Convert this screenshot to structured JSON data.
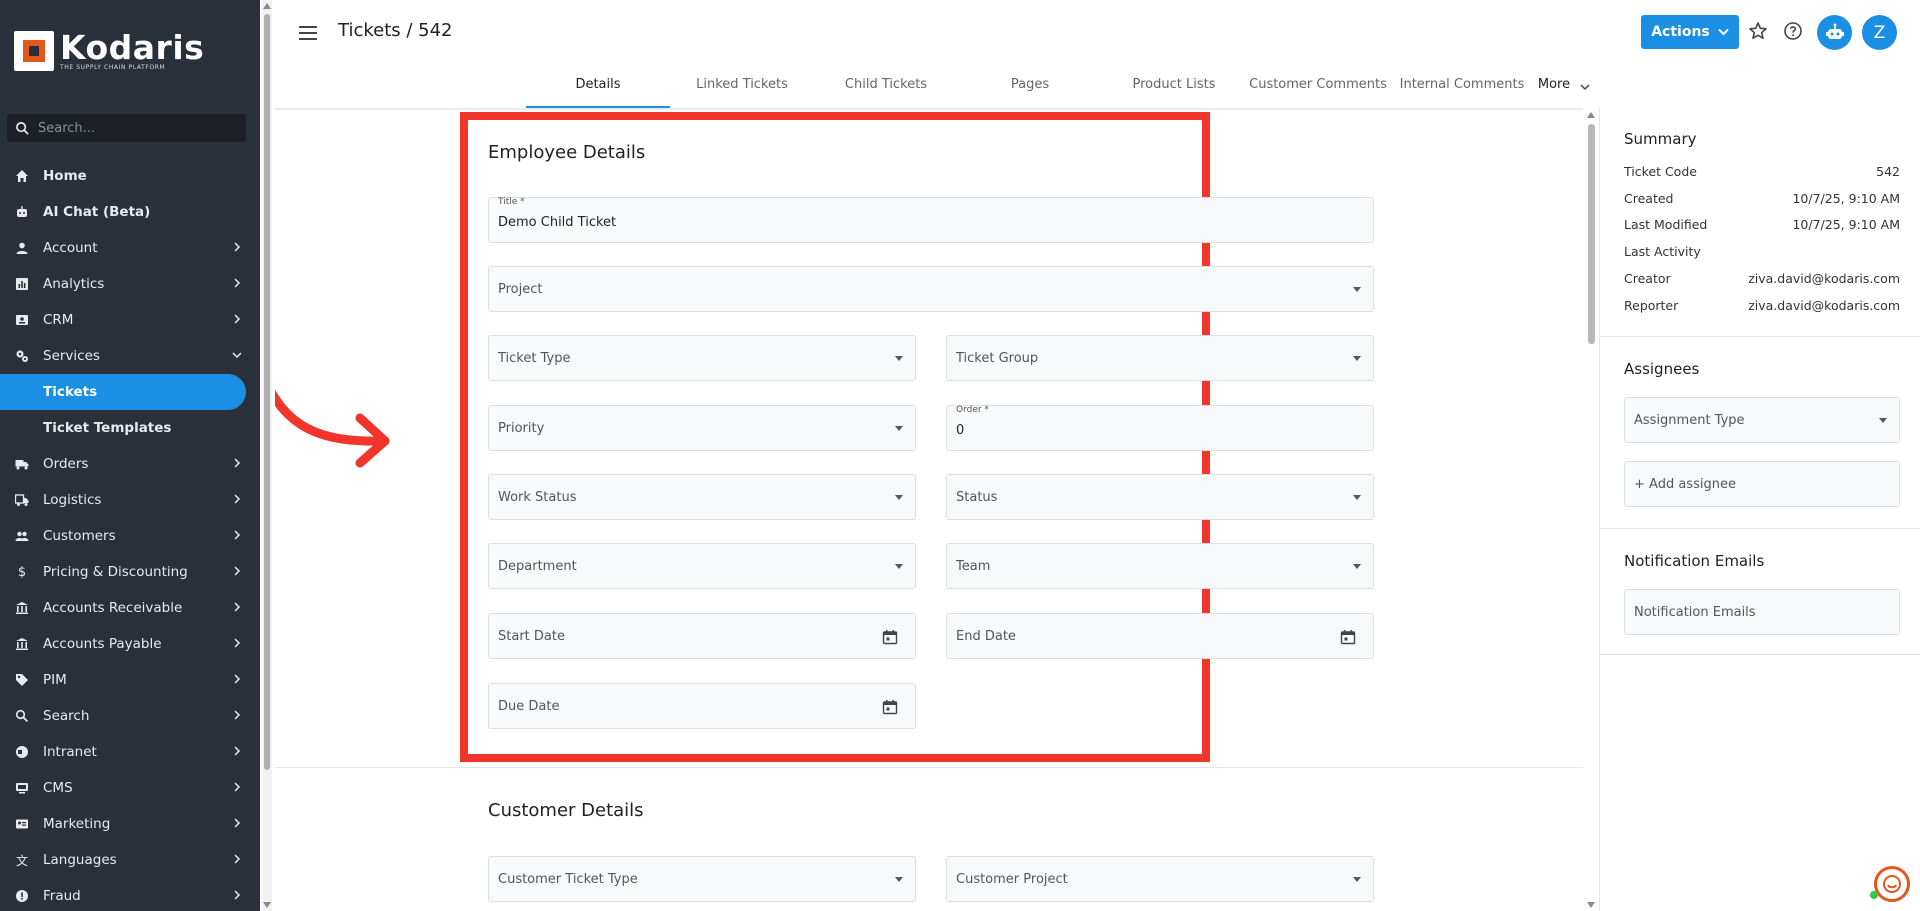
{
  "sidebar": {
    "logo_name": "Kodaris",
    "logo_tagline": "THE SUPPLY CHAIN PLATFORM",
    "search_placeholder": "Search...",
    "items": [
      {
        "label": "Home",
        "icon": "home-icon"
      },
      {
        "label": "AI Chat (Beta)",
        "icon": "robot-icon"
      },
      {
        "label": "Account",
        "icon": "person-icon"
      },
      {
        "label": "Analytics",
        "icon": "chart-icon"
      },
      {
        "label": "CRM",
        "icon": "contacts-icon"
      },
      {
        "label": "Services",
        "icon": "gears-icon"
      },
      {
        "label": "Tickets"
      },
      {
        "label": "Ticket Templates"
      },
      {
        "label": "Orders",
        "icon": "truck-icon"
      },
      {
        "label": "Logistics",
        "icon": "shipping-icon"
      },
      {
        "label": "Customers",
        "icon": "people-icon"
      },
      {
        "label": "Pricing & Discounting",
        "icon": "dollar-icon"
      },
      {
        "label": "Accounts Receivable",
        "icon": "bank-icon"
      },
      {
        "label": "Accounts Payable",
        "icon": "bank-icon"
      },
      {
        "label": "PIM",
        "icon": "tag-icon"
      },
      {
        "label": "Search",
        "icon": "search-icon"
      },
      {
        "label": "Intranet",
        "icon": "globe-icon"
      },
      {
        "label": "CMS",
        "icon": "monitor-icon"
      },
      {
        "label": "Marketing",
        "icon": "id-card-icon"
      },
      {
        "label": "Languages",
        "icon": "translate-icon"
      },
      {
        "label": "Fraud",
        "icon": "alert-icon"
      }
    ]
  },
  "header": {
    "title": "Tickets / 542",
    "actions_label": "Actions",
    "avatar_initial": "Z"
  },
  "tabs": [
    "Details",
    "Linked Tickets",
    "Child Tickets",
    "Pages",
    "Product Lists",
    "Customer Comments",
    "Internal Comments",
    "More"
  ],
  "employee_details": {
    "title": "Employee Details",
    "title_field_label": "Title *",
    "title_field_value": "Demo Child Ticket",
    "project": "Project",
    "ticket_type": "Ticket Type",
    "ticket_group": "Ticket Group",
    "priority": "Priority",
    "order_label": "Order *",
    "order_value": "0",
    "work_status": "Work Status",
    "status": "Status",
    "department": "Department",
    "team": "Team",
    "start_date": "Start Date",
    "end_date": "End Date",
    "due_date": "Due Date"
  },
  "customer_details": {
    "title": "Customer Details",
    "customer_ticket_type": "Customer Ticket Type",
    "customer_project": "Customer Project"
  },
  "summary": {
    "title": "Summary",
    "rows": [
      {
        "label": "Ticket Code",
        "value": "542"
      },
      {
        "label": "Created",
        "value": "10/7/25, 9:10 AM"
      },
      {
        "label": "Last Modified",
        "value": "10/7/25, 9:10 AM"
      },
      {
        "label": "Last Activity",
        "value": ""
      },
      {
        "label": "Creator",
        "value": "ziva.david@kodaris.com"
      },
      {
        "label": "Reporter",
        "value": "ziva.david@kodaris.com"
      }
    ]
  },
  "assignees": {
    "title": "Assignees",
    "assignment_type": "Assignment Type",
    "add_assignee": "+ Add assignee"
  },
  "notification": {
    "title": "Notification Emails",
    "placeholder": "Notification Emails"
  },
  "colors": {
    "accent": "#1a8fe3",
    "sidebar_bg": "#2a3039",
    "highlight": "#f2352a",
    "brand_orange": "#e4561b"
  }
}
